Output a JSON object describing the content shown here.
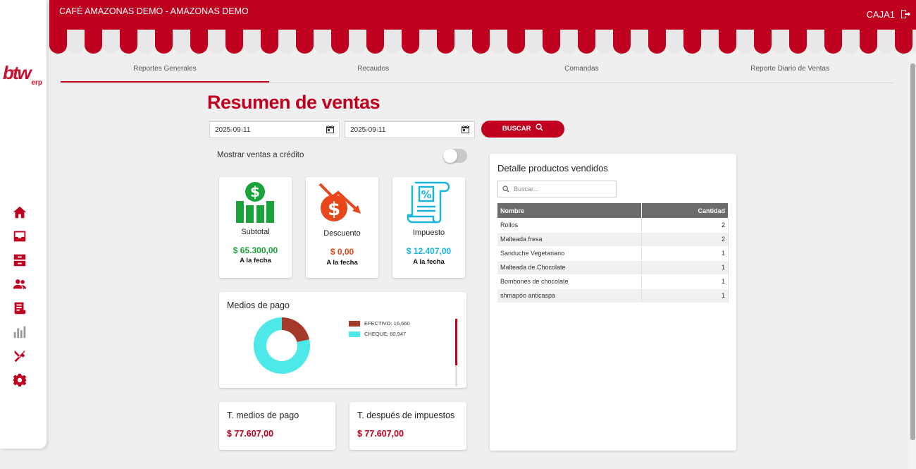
{
  "header": {
    "title": "CAFÉ AMAZONAS DEMO - AMAZONAS DEMO",
    "user": "CAJA1"
  },
  "logo": {
    "mark": "btw",
    "sub": "erp"
  },
  "sidebar": {
    "items": [
      "home-icon",
      "inbox-icon",
      "archive-icon",
      "users-icon",
      "receipt-icon",
      "chart-icon",
      "restaurant-icon",
      "gear-icon"
    ]
  },
  "tabs": [
    "Reportes Generales",
    "Recaudos",
    "Comandas",
    "Reporte Diario de Ventas"
  ],
  "page": {
    "title": "Resumen de ventas"
  },
  "filters": {
    "date_from": "2025-09-11",
    "date_to": "2025-09-11",
    "search_button": "BUSCAR",
    "credit_toggle_label": "Mostrar ventas a crédito"
  },
  "stats": [
    {
      "label": "Subtotal",
      "value": "$ 65.300,00",
      "sub": "A la fecha",
      "color": "#1aa33a"
    },
    {
      "label": "Descuento",
      "value": "$ 0,00",
      "sub": "A la fecha",
      "color": "#e8471c"
    },
    {
      "label": "Impuesto",
      "value": "$ 12.407,00",
      "sub": "A la fecha",
      "color": "#1cb3dd"
    }
  ],
  "payments": {
    "title": "Medios de pago",
    "chart_data": {
      "type": "pie",
      "categories": [
        "EFECTIVO",
        "CHEQUE"
      ],
      "values": [
        16660,
        60947
      ],
      "colors": [
        "#a63a2a",
        "#4de8e8"
      ],
      "legend": [
        "EFECTIVO: 16,660",
        "CHEQUE: 60,947"
      ]
    }
  },
  "totals": [
    {
      "label": "T. medios de pago",
      "value": "$ 77.607,00"
    },
    {
      "label": "T. después de impuestos",
      "value": "$ 77.607,00"
    }
  ],
  "products": {
    "title": "Detalle productos vendidos",
    "search_placeholder": "Buscar...",
    "columns": [
      "Nombre",
      "Cantidad"
    ],
    "rows": [
      [
        "Rollos",
        "2"
      ],
      [
        "Malteada fresa",
        "2"
      ],
      [
        "Sanduche Vegetariano",
        "1"
      ],
      [
        "Malteada de Chocolate",
        "1"
      ],
      [
        "Bombones de chocolate",
        "1"
      ],
      [
        "shmapóo anticaspa",
        "1"
      ]
    ]
  },
  "colors": {
    "brand": "#c0001f"
  }
}
